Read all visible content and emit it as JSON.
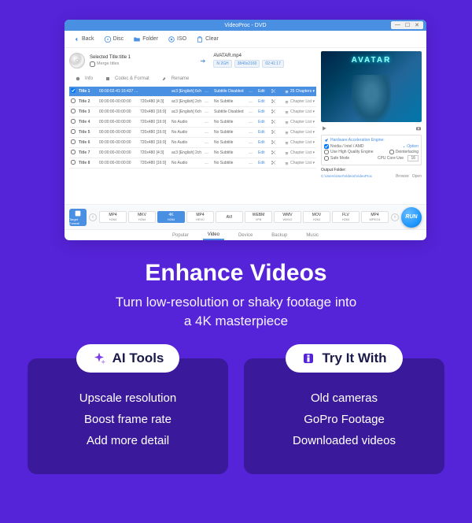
{
  "window": {
    "title": "VideoProc - DVD"
  },
  "toolbar": {
    "back": "Back",
    "disc": "Disc",
    "folder": "Folder",
    "iso": "ISO",
    "clear": "Clear"
  },
  "file": {
    "selected_label": "Selected Title:title 1",
    "merge": "Merge titles",
    "output_name": "AVATAR.mp4",
    "badge_size": "N 2GH",
    "badge_res": "3840x2160",
    "badge_dur": "02:41:17"
  },
  "tabs": {
    "info": "Info",
    "codec": "Codec & Format",
    "rename": "Rename"
  },
  "rows": [
    {
      "title": "Title 1",
      "time": "00:00:02-41:16:437 [16:9]",
      "res": "",
      "audio": "ac3 [English] 6ch",
      "ach": "…",
      "sub": "Subtitle Disabled",
      "sch": "…",
      "edit": "Edit",
      "chap": "25 Chapters",
      "sel": true
    },
    {
      "title": "Title 2",
      "time": "00:00:00-00:00:00",
      "res": "720x480 [4:3]",
      "audio": "ac3 [English] 2ch",
      "ach": "…",
      "sub": "No Subtitle",
      "sch": "…",
      "edit": "Edit",
      "chap": "Chapter List"
    },
    {
      "title": "Title 3",
      "time": "00:00:00-00:00:00",
      "res": "720x480 [16:9]",
      "audio": "ac3 [English] 6ch",
      "ach": "…",
      "sub": "Subtitle Disabled",
      "sch": "…",
      "edit": "Edit",
      "chap": "Chapter List"
    },
    {
      "title": "Title 4",
      "time": "00:00:00-00:00:00",
      "res": "720x480 [16:9]",
      "audio": "No Audio",
      "ach": "…",
      "sub": "No Subtitle",
      "sch": "…",
      "edit": "Edit",
      "chap": "Chapter List"
    },
    {
      "title": "Title 5",
      "time": "00:00:00-00:00:00",
      "res": "720x480 [16:9]",
      "audio": "No Audio",
      "ach": "…",
      "sub": "No Subtitle",
      "sch": "…",
      "edit": "Edit",
      "chap": "Chapter List"
    },
    {
      "title": "Title 6",
      "time": "00:00:00-00:00:00",
      "res": "720x480 [16:9]",
      "audio": "No Audio",
      "ach": "…",
      "sub": "No Subtitle",
      "sch": "…",
      "edit": "Edit",
      "chap": "Chapter List"
    },
    {
      "title": "Title 7",
      "time": "00:00:00-00:00:00",
      "res": "720x480 [4:3]",
      "audio": "ac3 [English] 2ch",
      "ach": "…",
      "sub": "No Subtitle",
      "sch": "…",
      "edit": "Edit",
      "chap": "Chapter List"
    },
    {
      "title": "Title 8",
      "time": "00:00:00-00:00:00",
      "res": "720x480 [16:9]",
      "audio": "No Audio",
      "ach": "…",
      "sub": "No Subtitle",
      "sch": "…",
      "edit": "Edit",
      "chap": "Chapter List"
    }
  ],
  "preview": {
    "logo": "AVATAR"
  },
  "hw": {
    "title": "Hardware Acceleration Engine:",
    "chip": "Nvidia / Intel / AMD",
    "option": "Option",
    "hq": "Use High Quality Engine",
    "deint": "Deinterlacing",
    "safe": "Safe Mode",
    "cpu_lbl": "CPU Core Use",
    "cpu_val": "16"
  },
  "output": {
    "label": "Output Folder:",
    "path": "C:\\Users\\User\\Videos\\VideoProc",
    "browse": "Browse",
    "open": "Open"
  },
  "target": {
    "label": "Target Format"
  },
  "formats": [
    {
      "t": "MP4",
      "c": "H264"
    },
    {
      "t": "MKV",
      "c": "H264"
    },
    {
      "t": "4K",
      "c": "H264",
      "act": true
    },
    {
      "t": "MP4",
      "c": "HEVC"
    },
    {
      "t": "AVI",
      "c": ""
    },
    {
      "t": "WEBM",
      "c": "VP8"
    },
    {
      "t": "WMV",
      "c": "WMV2"
    },
    {
      "t": "MOV",
      "c": "H264"
    },
    {
      "t": "FLV",
      "c": "H264"
    },
    {
      "t": "MP4",
      "c": "MPEG4"
    }
  ],
  "run": "RUN",
  "bottom_tabs": {
    "popular": "Popular",
    "video": "Video",
    "device": "Device",
    "backup": "Backup",
    "music": "Music"
  },
  "hero": {
    "title": "Enhance Videos",
    "sub1": "Turn low-resolution or shaky footage into",
    "sub2": "a 4K masterpiece"
  },
  "cards": {
    "left": {
      "title": "AI Tools",
      "items": [
        "Upscale resolution",
        "Boost frame rate",
        "Add more detail"
      ]
    },
    "right": {
      "title": "Try It With",
      "items": [
        "Old cameras",
        "GoPro Footage",
        "Downloaded videos"
      ]
    }
  }
}
